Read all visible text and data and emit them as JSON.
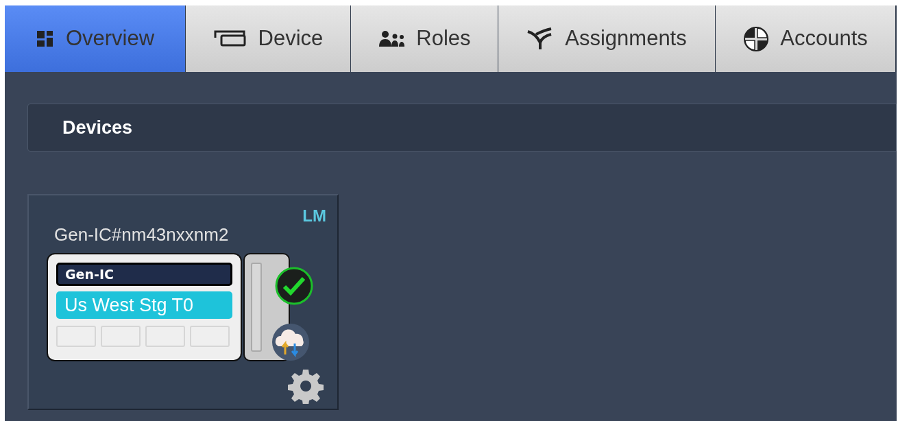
{
  "tabs": [
    {
      "label": "Overview",
      "selected": true
    },
    {
      "label": "Device",
      "selected": false
    },
    {
      "label": "Roles",
      "selected": false
    },
    {
      "label": "Assignments",
      "selected": false
    },
    {
      "label": "Accounts",
      "selected": false
    }
  ],
  "section": {
    "title": "Devices"
  },
  "devices": [
    {
      "name": "Gen-IC#nm43nxxnm2",
      "badge": "LM",
      "type": "Gen-IC",
      "label": "Us West Stg T0",
      "healthy": true
    }
  ]
}
